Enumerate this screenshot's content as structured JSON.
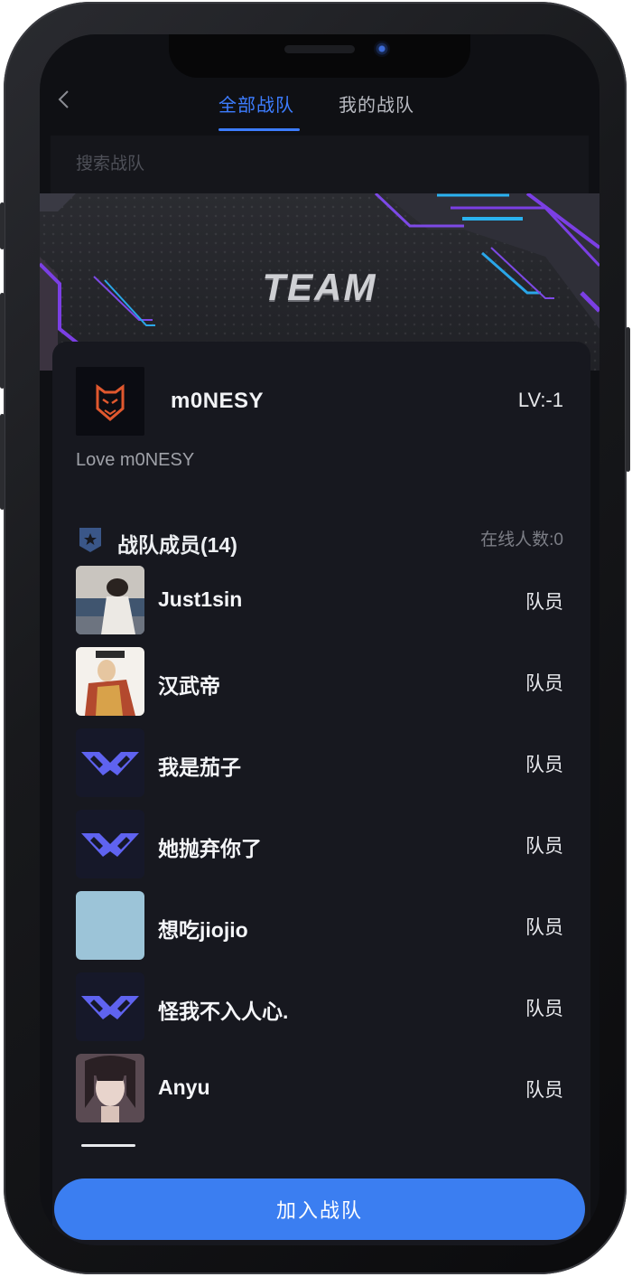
{
  "header": {
    "tabs": [
      {
        "label": "全部战队",
        "active": true
      },
      {
        "label": "我的战队",
        "active": false
      }
    ]
  },
  "search": {
    "placeholder": "搜索战队"
  },
  "banner": {
    "title": "TEAM"
  },
  "team": {
    "name": "m0NESY",
    "level": "LV:-1",
    "description": "Love m0NESY",
    "logo_icon": "g2-esports-logo"
  },
  "members_section": {
    "title": "战队成员(14)",
    "online": "在线人数:0"
  },
  "members": [
    {
      "name": "Just1sin",
      "role": "队员",
      "avatar": "photo-person"
    },
    {
      "name": "汉武帝",
      "role": "队员",
      "avatar": "photo-emperor"
    },
    {
      "name": "我是茄子",
      "role": "队员",
      "avatar": "hh-logo"
    },
    {
      "name": "她抛弃你了",
      "role": "队员",
      "avatar": "hh-logo"
    },
    {
      "name": "想吃jiojio",
      "role": "队员",
      "avatar": "light-blue-square"
    },
    {
      "name": "怪我不入人心.",
      "role": "队员",
      "avatar": "hh-logo"
    },
    {
      "name": "Anyu",
      "role": "队员",
      "avatar": "anime-portrait"
    }
  ],
  "join_button": {
    "label": "加入战队"
  },
  "colors": {
    "accent": "#3d7dff",
    "button": "#3b7ef1",
    "card_bg": "#17181f",
    "screen_bg": "#0f1014"
  }
}
